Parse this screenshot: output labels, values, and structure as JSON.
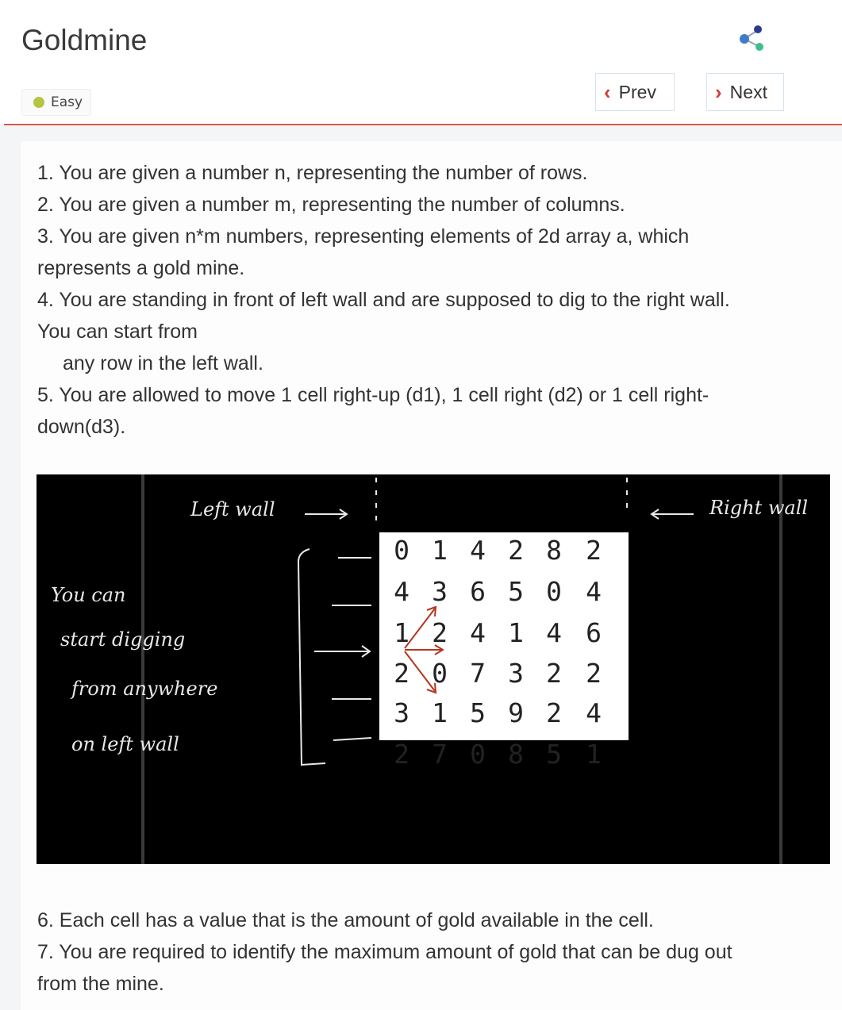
{
  "header": {
    "title": "Goldmine",
    "difficulty": "Easy",
    "difficulty_color": "#b5c542",
    "prev_label": "Prev",
    "next_label": "Next",
    "share_icon": "share-icon",
    "accent": "#d9564d"
  },
  "problem": {
    "lines": [
      "1. You are given a number n, representing the number of rows.",
      "2. You are given a number m, representing the number of columns.",
      "3. You are given n*m numbers, representing elements of 2d array a, which",
      "represents a gold mine.",
      "4. You are standing in front of left wall and are supposed to dig to the right wall.",
      "You can start from",
      "any row in the left wall.",
      "5. You are allowed to move 1 cell right-up (d1), 1 cell right (d2) or 1 cell right-",
      "down(d3)."
    ],
    "lines_after": [
      "6. Each cell has a value that is the amount of gold available in the cell.",
      "7. You are required to identify the maximum amount of gold that can be dug out",
      "from the mine."
    ]
  },
  "illustration": {
    "left_wall_label": "Left wall",
    "right_wall_label": "Right wall",
    "note": [
      "You can",
      "start digging",
      "from anywhere",
      "on left wall"
    ],
    "grid": [
      [
        "0",
        "1",
        "4",
        "2",
        "8",
        "2"
      ],
      [
        "4",
        "3",
        "6",
        "5",
        "0",
        "4"
      ],
      [
        "1",
        "2",
        "4",
        "1",
        "4",
        "6"
      ],
      [
        "2",
        "0",
        "7",
        "3",
        "2",
        "2"
      ],
      [
        "3",
        "1",
        "5",
        "9",
        "2",
        "4"
      ],
      [
        "2",
        "7",
        "0",
        "8",
        "5",
        "1"
      ]
    ],
    "arrow_color": "#b5351f"
  }
}
